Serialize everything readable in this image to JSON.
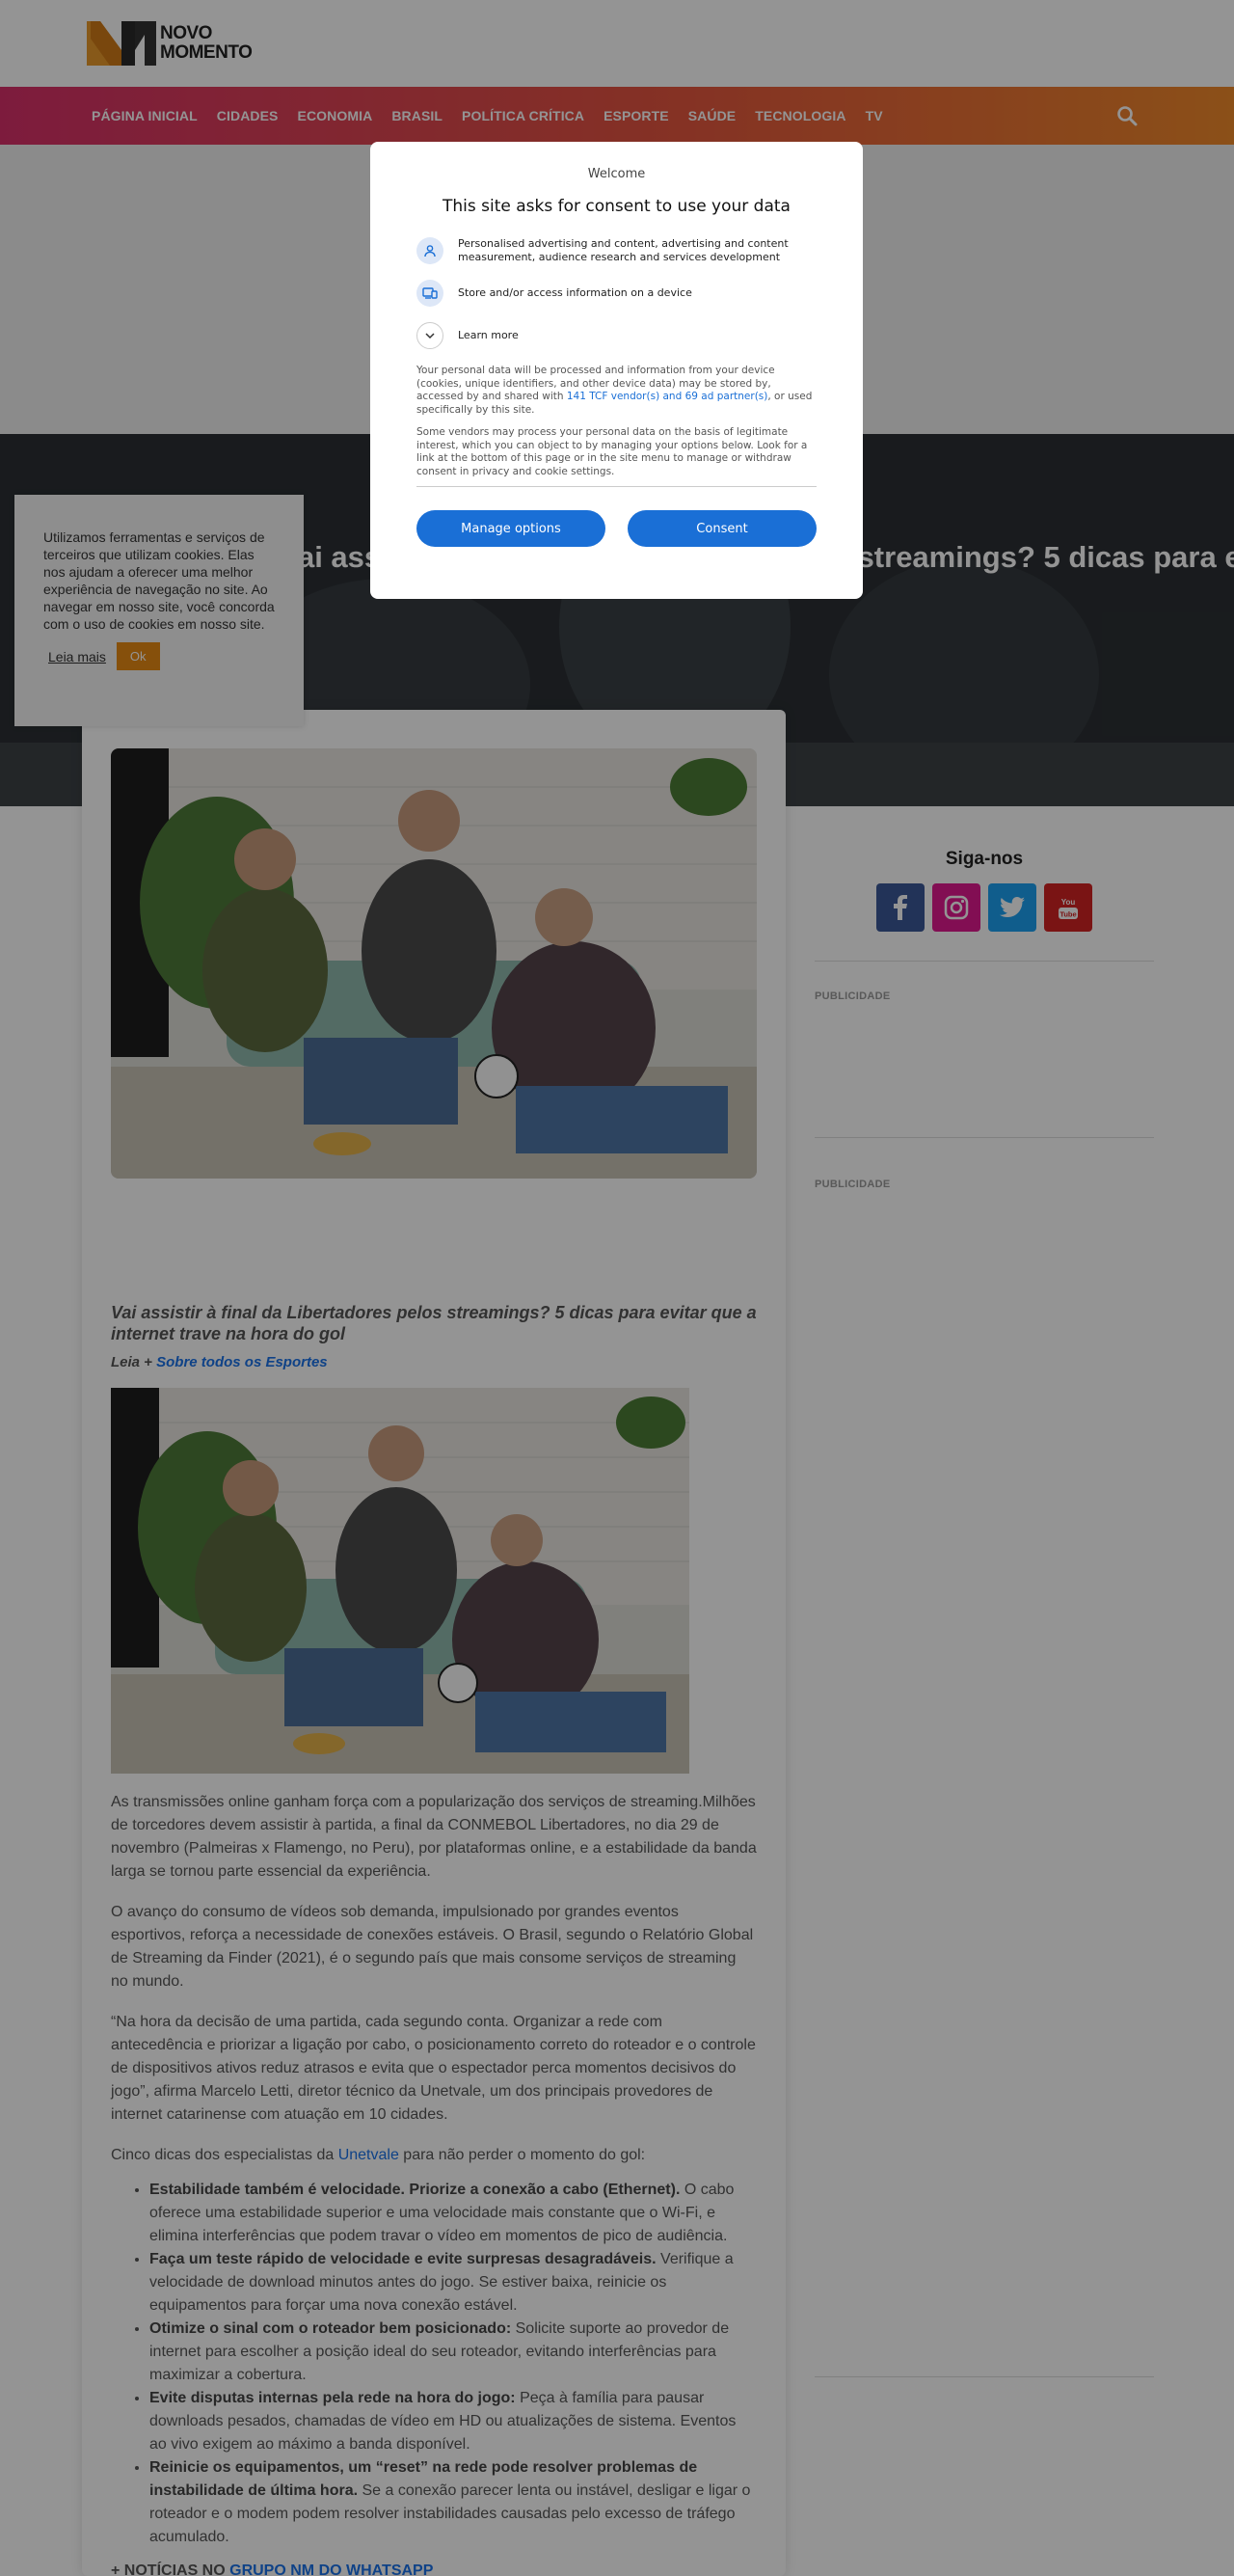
{
  "brand": {
    "line1": "NOVO",
    "line2": "MOMENTO"
  },
  "nav": {
    "items": [
      "PÁGINA INICIAL",
      "CIDADES",
      "ECONOMIA",
      "BRASIL",
      "POLÍTICA CRÍTICA",
      "ESPORTE",
      "SAÚDE",
      "TECNOLOGIA",
      "TV"
    ],
    "search_icon": "search-icon"
  },
  "hero": {
    "title": "Vai assistir à final da Libertadores pelos streamings? 5 dicas para evitar que a internet trave"
  },
  "article": {
    "subtitle": "Vai assistir à final da Libertadores pelos streamings? 5 dicas para evitar que a internet trave na hora do gol",
    "read_more_prefix": "Leia + ",
    "read_more_link": "Sobre todos os Esportes",
    "p1": "As transmissões online ganham força com a popularização dos serviços de streaming.Milhões de torcedores devem assistir à partida, a final da CONMEBOL Libertadores, no dia 29 de novembro (Palmeiras x Flamengo, no Peru), por plataformas online, e a estabilidade da banda larga se tornou parte essencial da experiência.",
    "p2": "O avanço do consumo de vídeos sob demanda, impulsionado por grandes eventos esportivos, reforça a necessidade de conexões estáveis. O Brasil, segundo o Relatório Global de Streaming da Finder (2021), é o segundo país que mais consome serviços de streaming no mundo.",
    "p3": "“Na hora da decisão de uma partida, cada segundo conta. Organizar a rede com antecedência e priorizar a ligação por cabo, o posicionamento correto do roteador e o controle de dispositivos ativos reduz atrasos e evita que o espectador perca momentos decisivos do jogo”, afirma Marcelo Letti, diretor técnico da Unetvale, um dos principais provedores de internet catarinense com atuação em 10 cidades.",
    "p4_prefix": "Cinco dicas dos especialistas da ",
    "p4_link": "Unetvale",
    "p4_suffix": " para não perder o momento do gol:",
    "tips": [
      {
        "bold": "Estabilidade também é velocidade. Priorize a conexão a cabo (Ethernet).",
        "text": " O cabo oferece uma estabilidade superior e uma velocidade mais constante que o Wi-Fi, e elimina interferências que podem travar o vídeo em momentos de pico de audiência."
      },
      {
        "bold": "Faça um teste rápido de velocidade e evite surpresas desagradáveis.",
        "text": " Verifique a velocidade de download minutos antes do jogo. Se estiver baixa, reinicie os equipamentos para forçar uma nova conexão estável."
      },
      {
        "bold": "Otimize o sinal com o roteador bem posicionado:",
        "text": " Solicite suporte ao provedor de internet para escolher a posição ideal do seu roteador, evitando interferências para maximizar a cobertura."
      },
      {
        "bold": "Evite disputas internas pela rede na hora do jogo:",
        "text": " Peça à família para pausar downloads pesados, chamadas de vídeo em HD ou atualizações de sistema. Eventos ao vivo exigem ao máximo a banda disponível."
      },
      {
        "bold": "Reinicie os equipamentos, um “reset” na rede pode resolver problemas de instabilidade de última hora.",
        "text": " Se a conexão parecer lenta ou instável, desligar e ligar o roteador e o modem podem resolver instabilidades causadas pelo excesso de tráfego acumulado."
      }
    ],
    "whatsapp_prefix": "+ NOTÍCIAS NO ",
    "whatsapp_link": "GRUPO NM DO WHATSAPP"
  },
  "sidebar": {
    "follow_title": "Siga-nos",
    "social": [
      {
        "icon": "facebook-icon",
        "color": "#3b5998"
      },
      {
        "icon": "instagram-icon",
        "color": "#e1198f"
      },
      {
        "icon": "twitter-icon",
        "color": "#1da1f2"
      },
      {
        "icon": "youtube-icon",
        "color": "#d32323"
      }
    ],
    "ad_label_1": "PUBLICIDADE",
    "ad_label_2": "PUBLICIDADE"
  },
  "cookie_notice": {
    "text": "Utilizamos ferramentas e serviços de terceiros que utilizam cookies. Elas nos ajudam a oferecer uma melhor experiência de navegação no site. Ao navegar em nosso site, você concorda com o uso de cookies em nosso site.",
    "read_more": "Leia mais",
    "ok": "Ok"
  },
  "consent": {
    "welcome": "Welcome",
    "title": "This site asks for consent to use your data",
    "purpose_1": "Personalised advertising and content, advertising and content measurement, audience research and services development",
    "purpose_2": "Store and/or access information on a device",
    "learn_more": "Learn more",
    "info_1_prefix": "Your personal data will be processed and information from your device (cookies, unique identifiers, and other device data) may be stored by, accessed by and shared with ",
    "info_1_link": "141 TCF vendor(s) and 69 ad partner(s)",
    "info_1_suffix": ", or used specifically by this site.",
    "info_2": "Some vendors may process your personal data on the basis of legitimate interest, which you can object to by managing your options below. Look for a link at the bottom of this page or in the site menu to manage or withdraw consent in privacy and cookie settings.",
    "manage_options": "Manage options",
    "consent_button": "Consent"
  }
}
